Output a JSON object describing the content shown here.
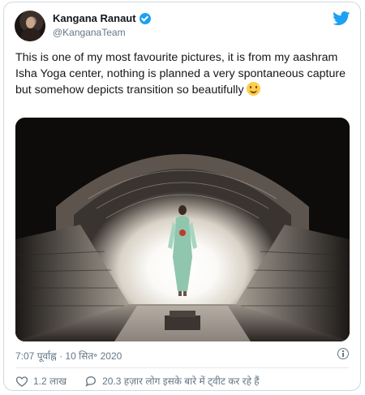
{
  "tweet": {
    "author_name": "Kangana Ranaut",
    "author_handle": "@KanganaTeam",
    "text": "This is one of my most favourite pictures, it is from my aashram Isha Yoga center, nothing is planned a very spontaneous capture but somehow depicts transition so beautifully",
    "emoji": "slightly-smiling-face",
    "timestamp": "7:07 पूर्वाह्न · 10 सित॰ 2020",
    "likes": "1.2 लाख",
    "conversation": "20.3 हज़ार लोग इसके बारे में ट्वीट कर रहे हैं"
  },
  "colors": {
    "verified": "#1da1f2",
    "twitter_brand": "#1da1f2",
    "muted_text": "#657786",
    "border": "#cfd9de"
  }
}
